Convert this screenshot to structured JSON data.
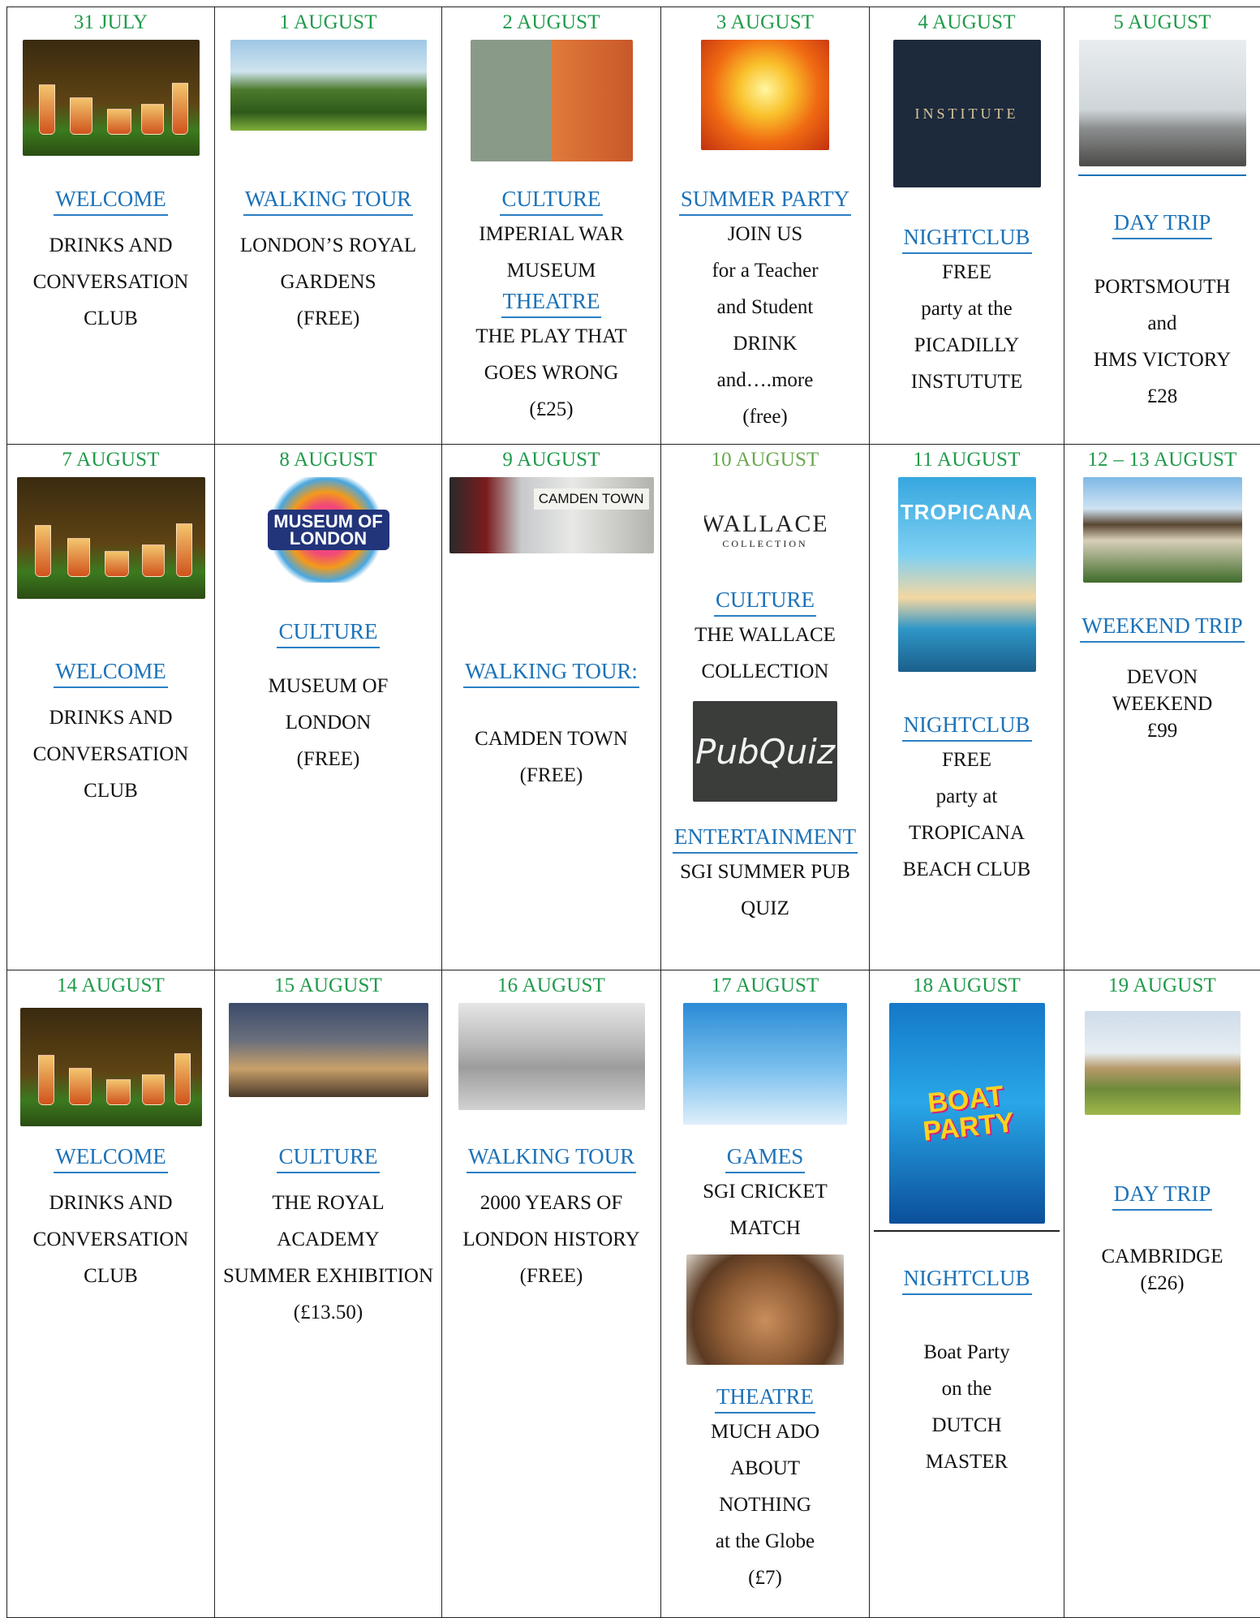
{
  "rows": [
    [
      {
        "date": "31 JULY",
        "image": "cocktails-photo",
        "category": "WELCOME",
        "lines": [
          "DRINKS AND",
          "CONVERSATION",
          "CLUB"
        ]
      },
      {
        "date": "1 AUGUST",
        "image": "park-photo",
        "category": "WALKING TOUR",
        "lines": [
          "LONDON’S ROYAL",
          "GARDENS",
          "(FREE)"
        ]
      },
      {
        "date": "2 AUGUST",
        "image": "war-museum-photo",
        "category": "CULTURE",
        "lines": [
          "IMPERIAL WAR",
          "MUSEUM"
        ],
        "category2": "THEATRE",
        "lines2": [
          "THE PLAY THAT",
          "GOES WRONG",
          "(£25)"
        ]
      },
      {
        "date": "3 AUGUST",
        "image": "summer-party-photo",
        "category": "SUMMER PARTY",
        "lines": [
          "JOIN US",
          "for a Teacher",
          "and Student",
          "DRINK",
          "and….more",
          "(free)"
        ]
      },
      {
        "date": "4 AUGUST",
        "image": "piccadilly-institute-logo",
        "image_text": "INSTITUTE",
        "category": "NIGHTCLUB",
        "lines": [
          "FREE",
          "party at the",
          "PICADILLY",
          "INSTUTUTE"
        ]
      },
      {
        "date": "5 AUGUST",
        "image": "hms-victory-photo",
        "category": "DAY TRIP",
        "lines": [
          "PORTSMOUTH",
          "and",
          "HMS VICTORY",
          "£28"
        ]
      }
    ],
    [
      {
        "date": "7 AUGUST",
        "image": "cocktails-photo",
        "category": "WELCOME",
        "lines": [
          "DRINKS AND",
          "CONVERSATION",
          "CLUB"
        ]
      },
      {
        "date": "8 AUGUST",
        "image": "museum-of-london-logo",
        "image_text": "MUSEUM OF LONDON",
        "category": "CULTURE",
        "lines": [
          "MUSEUM OF",
          "LONDON",
          "(FREE)"
        ]
      },
      {
        "date": "9 AUGUST",
        "image": "camden-town-station-photo",
        "image_text": "CAMDEN TOWN",
        "category": "WALKING TOUR:",
        "lines": [
          "CAMDEN TOWN",
          "(FREE)"
        ]
      },
      {
        "date": "10 AUGUST",
        "image": "wallace-collection-logo",
        "image_text": "WALLACE",
        "image_text2": "COLLECTION",
        "category": "CULTURE",
        "lines": [
          "THE WALLACE",
          "COLLECTION"
        ],
        "image2": "pub-quiz-chalkboard",
        "image2_text": "PubQuiz",
        "category2": "ENTERTAINMENT",
        "lines2": [
          "SGI SUMMER PUB",
          "QUIZ"
        ]
      },
      {
        "date": "11 AUGUST",
        "image": "tropicana-poster",
        "image_text": "TROPICANA",
        "category": "NIGHTCLUB",
        "lines": [
          "FREE",
          "party at",
          "TROPICANA",
          "BEACH CLUB"
        ]
      },
      {
        "date": "12 – 13 AUGUST",
        "image": "devon-group-photo",
        "category": "WEEKEND TRIP",
        "lines": [
          "DEVON",
          "WEEKEND",
          "£99"
        ]
      }
    ],
    [
      {
        "date": "14 AUGUST",
        "image": "cocktails-photo",
        "category": "WELCOME",
        "lines": [
          "DRINKS AND",
          "CONVERSATION",
          "CLUB"
        ]
      },
      {
        "date": "15 AUGUST",
        "image": "royal-academy-photo",
        "category": "CULTURE",
        "lines": [
          "THE ROYAL",
          "ACADEMY",
          "SUMMER EXHIBITION",
          "(£13.50)"
        ]
      },
      {
        "date": "16 AUGUST",
        "image": "old-london-engraving",
        "category": "WALKING TOUR",
        "lines": [
          "2000 YEARS OF",
          "LONDON HISTORY",
          "(FREE)"
        ]
      },
      {
        "date": "17 AUGUST",
        "image": "cricket-stumps-photo",
        "category": "GAMES",
        "lines": [
          "SGI CRICKET",
          "MATCH"
        ],
        "image2": "globe-theatre-photo",
        "category2": "THEATRE",
        "lines2": [
          "MUCH ADO",
          "ABOUT",
          "NOTHING",
          "at the Globe",
          "(£7)"
        ]
      },
      {
        "date": "18 AUGUST",
        "image": "boat-party-poster",
        "image_text": "BOAT PARTY",
        "category": "NIGHTCLUB",
        "lines": [
          "Boat Party",
          "on the",
          "DUTCH",
          "MASTER"
        ]
      },
      {
        "date": "19 AUGUST",
        "image": "cambridge-photo",
        "category": "DAY TRIP",
        "lines": [
          "CAMBRIDGE",
          "(£26)"
        ]
      }
    ]
  ]
}
